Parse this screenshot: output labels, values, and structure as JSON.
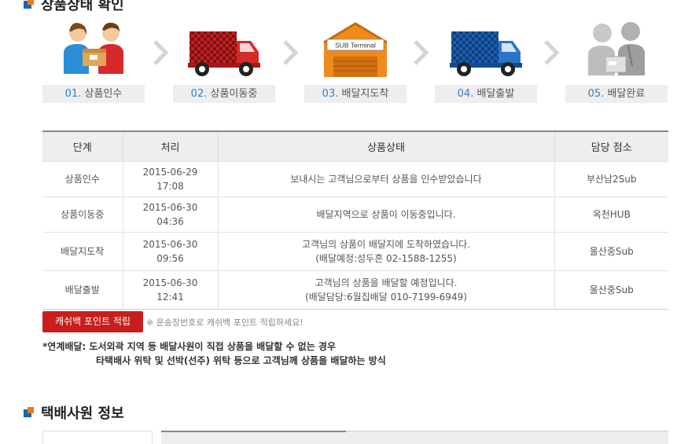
{
  "section1": {
    "title": "상품상태 확인"
  },
  "steps": [
    {
      "num": "01.",
      "label": "상품인수",
      "icon": "handover-icon"
    },
    {
      "num": "02.",
      "label": "상품이동중",
      "icon": "truck-red-icon"
    },
    {
      "num": "03.",
      "label": "배달지도착",
      "icon": "terminal-icon",
      "sign": "SUB Terminal"
    },
    {
      "num": "04.",
      "label": "배달출발",
      "icon": "truck-blue-icon"
    },
    {
      "num": "05.",
      "label": "배달완료",
      "icon": "delivered-icon"
    }
  ],
  "table": {
    "headers": [
      "단계",
      "처리",
      "상품상태",
      "담당 점소"
    ],
    "rows": [
      {
        "stage": "상품인수",
        "time": "2015-06-29 17:08",
        "status": "보내시는 고객님으로부터 상품을 인수받았습니다",
        "status2": "",
        "branch": "부산남2Sub"
      },
      {
        "stage": "상품이동중",
        "time": "2015-06-30 04:36",
        "status": "배달지역으로 상품이 이동중입니다.",
        "status2": "",
        "branch": "옥천HUB"
      },
      {
        "stage": "배달지도착",
        "time": "2015-06-30 09:56",
        "status": "고객님의 상품이 배달지에 도착하였습니다.",
        "status2": "(배달예정:성두흔 02-1588-1255)",
        "branch": "울산중Sub"
      },
      {
        "stage": "배달출발",
        "time": "2015-06-30 12:41",
        "status": "고객님의 상품을 배달할 예정입니다.",
        "status2": "(배달담당:6월집배달 010-7199-6949)",
        "branch": "울산중Sub"
      }
    ]
  },
  "cashbag": {
    "button": "캐쉬백 포인트 적립",
    "note": "※ 운송장번호로 캐쉬백 포인트 적립하세요!"
  },
  "linked_delivery": {
    "line1": "*연계배달: 도서외곽 지역 등 배달사원이 직접 상품을 배달할 수 없는 경우",
    "line2": "타택배사 위탁 및 선박(선주) 위탁 등으로 고객님께 상품을 배달하는 방식"
  },
  "section2": {
    "title": "택배사원 정보"
  },
  "colors": {
    "accent_blue": "#2f7fd1",
    "button_red": "#c81e1e",
    "icon_orange": "#f07a13",
    "icon_blue": "#1d62b5"
  }
}
